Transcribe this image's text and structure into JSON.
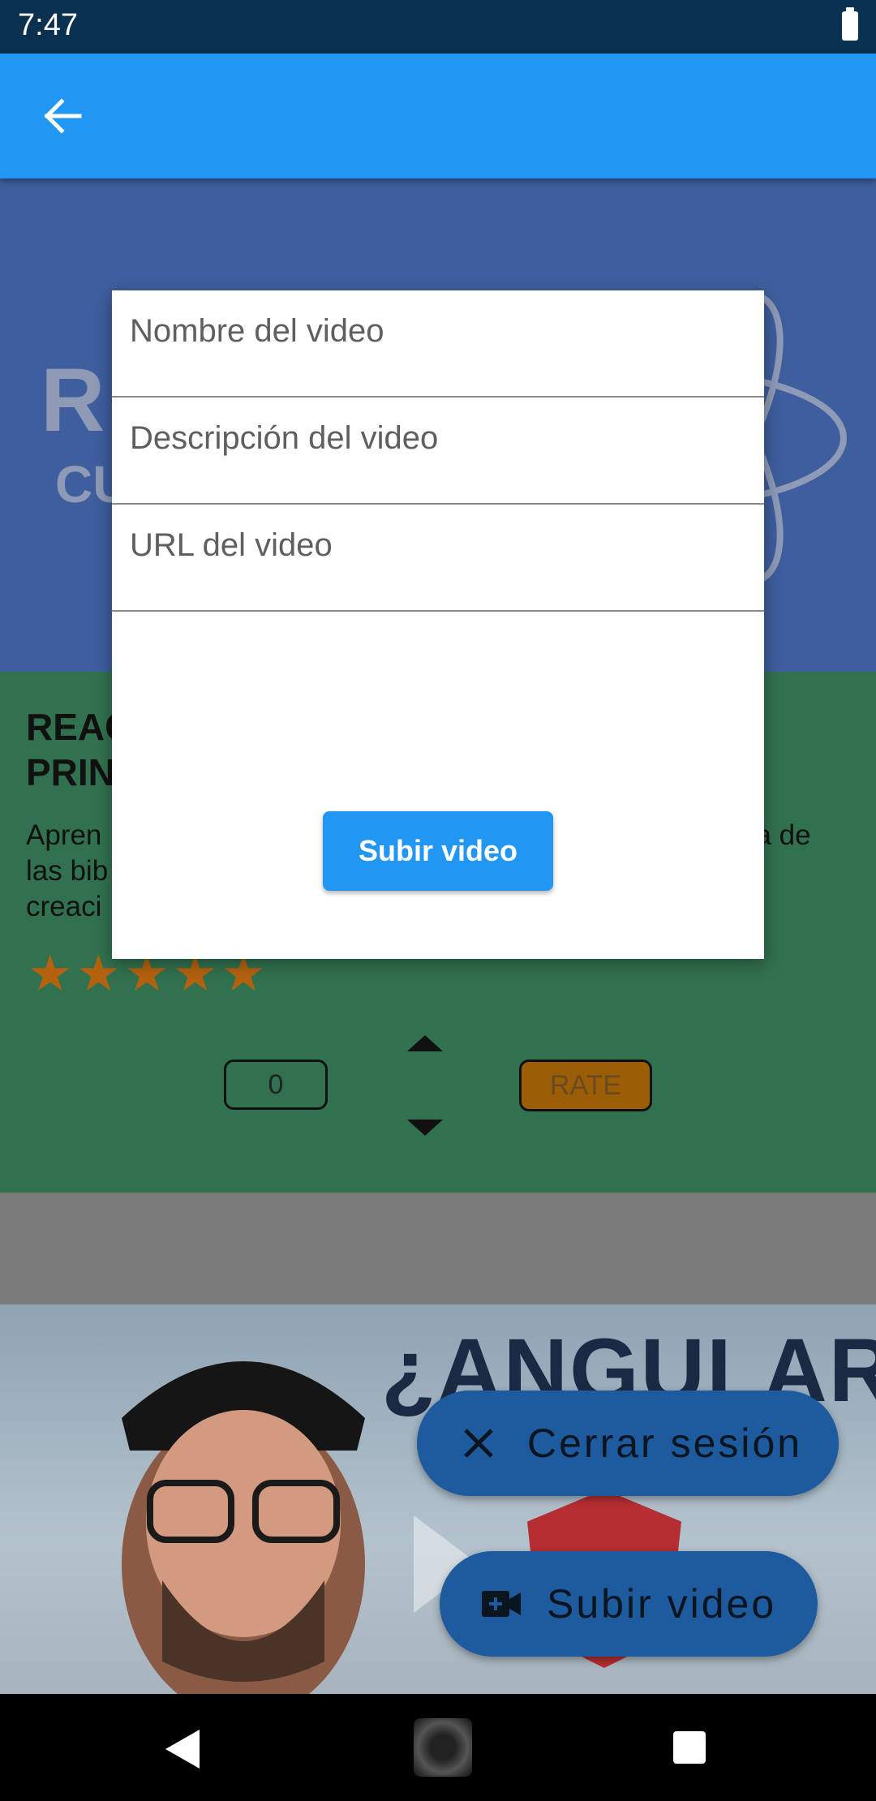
{
  "status_bar": {
    "time": "7:47"
  },
  "app_bar": {
    "back_icon": "arrow-left-icon"
  },
  "background": {
    "react_thumbnail_text": {
      "line1": "R",
      "line2": "CU"
    },
    "react_card": {
      "title_visible": "REAC\nPRIN",
      "description_left": "Apren\nlas bib\ncreaci",
      "description_right": "na de",
      "stars": "★★★★★",
      "rating_value": "0",
      "rate_label": "RATE"
    },
    "angular_thumbnail_text": "¿ANGULAR?"
  },
  "fabs": {
    "logout": {
      "label": "Cerrar sesión",
      "icon": "close-icon"
    },
    "upload": {
      "label": "Subir video",
      "icon": "video-plus-icon"
    }
  },
  "dialog": {
    "name_placeholder": "Nombre del video",
    "description_placeholder": "Descripción del video",
    "url_placeholder": "URL del video",
    "submit_label": "Subir video"
  },
  "colors": {
    "app_bar": "#2196f3",
    "status_bar": "#0b3150",
    "card": "#31714f",
    "star": "#b5620f",
    "fab": "#1d5a9e"
  }
}
